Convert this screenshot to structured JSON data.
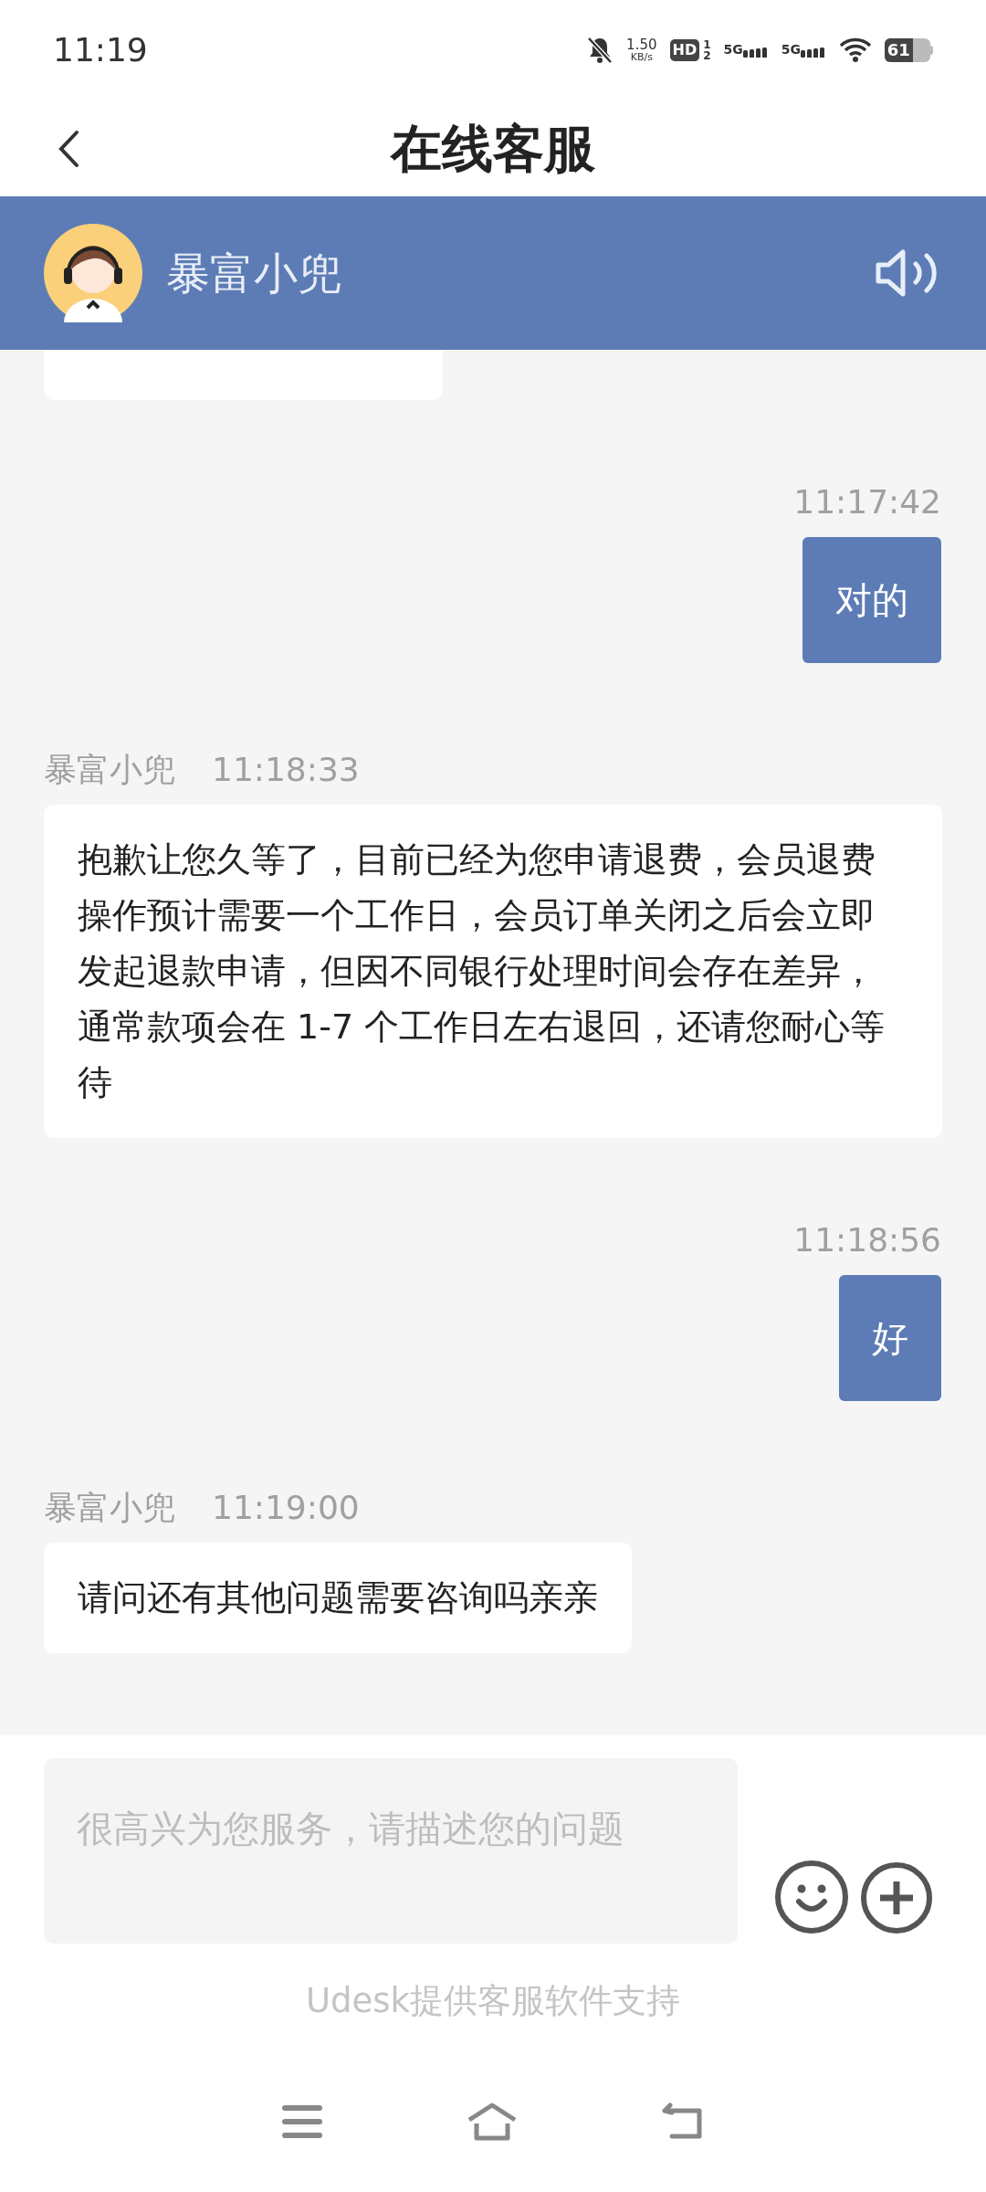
{
  "status_bar": {
    "time": "11:19",
    "speed": "1.50",
    "speed_unit": "KB/s",
    "hd": "HD",
    "sims": [
      "1",
      "2"
    ],
    "networks": [
      "5G",
      "5G"
    ],
    "battery": "61"
  },
  "header": {
    "title": "在线客服"
  },
  "agent": {
    "name": "暴富小兜"
  },
  "messages": [
    {
      "kind": "clipped"
    },
    {
      "kind": "user",
      "time": "11:17:42",
      "text": "对的"
    },
    {
      "kind": "agent",
      "sender": "暴富小兜",
      "time": "11:18:33",
      "text": "抱歉让您久等了，目前已经为您申请退费，会员退费操作预计需要一个工作日，会员订单关闭之后会立即发起退款申请，但因不同银行处理时间会存在差异，通常款项会在 1-7 个工作日左右退回，还请您耐心等待"
    },
    {
      "kind": "user",
      "time": "11:18:56",
      "text": "好"
    },
    {
      "kind": "agent",
      "sender": "暴富小兜",
      "time": "11:19:00",
      "text": "请问还有其他问题需要咨询吗亲亲"
    }
  ],
  "composer": {
    "placeholder": "很高兴为您服务，请描述您的问题"
  },
  "footer": "Udesk提供客服软件支持"
}
